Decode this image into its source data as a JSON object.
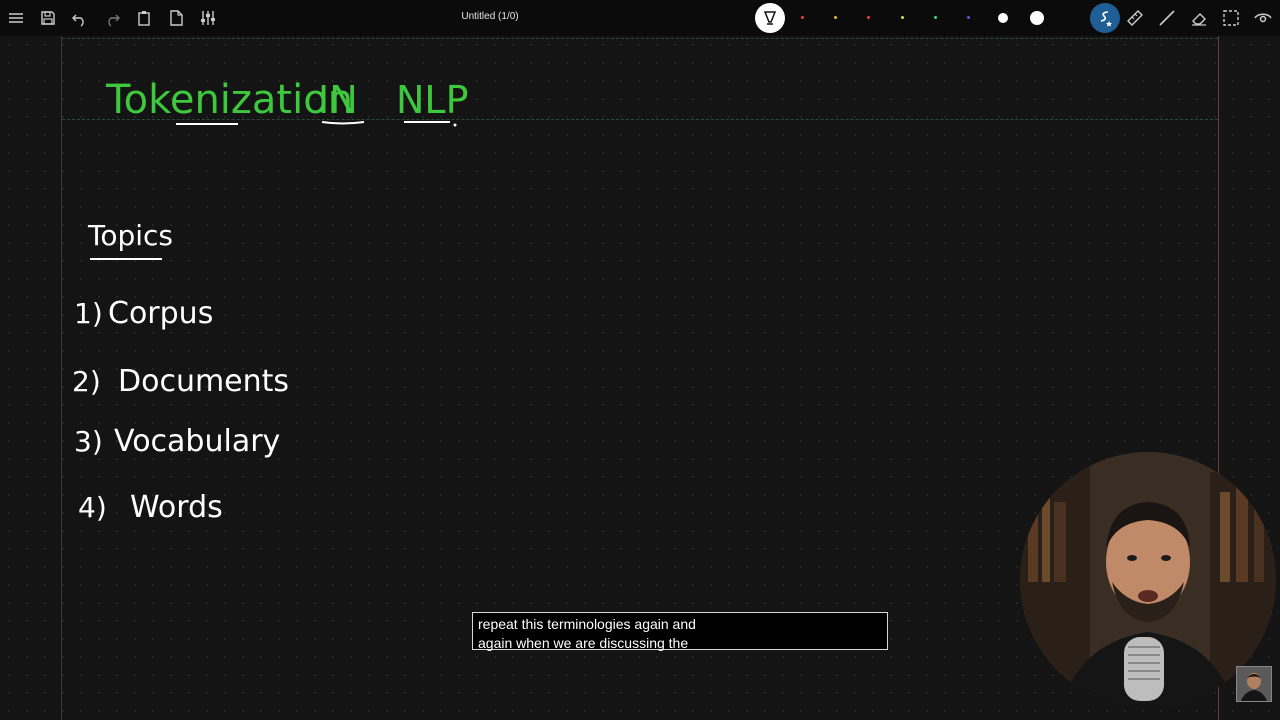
{
  "toolbar": {
    "doc_title": "Untitled (1/0)",
    "left_icons": [
      "menu-icon",
      "save-icon",
      "undo-icon",
      "redo-icon",
      "paste-icon",
      "new-page-icon",
      "settings-sliders-icon"
    ],
    "active_tool": "pen-icon",
    "swatch_colors": [
      "#e0443a",
      "#e8b83a",
      "#e0443a",
      "#d8d84a",
      "#3ad87a",
      "#7a4ad8"
    ],
    "right_icons": [
      "stylus-icon",
      "ruler-icon",
      "line-icon",
      "eraser-icon",
      "selection-icon",
      "eye-icon"
    ]
  },
  "canvas": {
    "title_words": [
      "Tokenization",
      "IN",
      "NLP"
    ],
    "title_color": "#3ec83e",
    "topics_heading": "Topics",
    "topics": [
      {
        "num": "1)",
        "label": "Corpus"
      },
      {
        "num": "2)",
        "label": "Documents"
      },
      {
        "num": "3)",
        "label": "Vocabulary"
      },
      {
        "num": "4)",
        "label": "Words"
      }
    ]
  },
  "caption": {
    "line1": "repeat this terminologies again and",
    "line2": "again when we are discussing the"
  }
}
